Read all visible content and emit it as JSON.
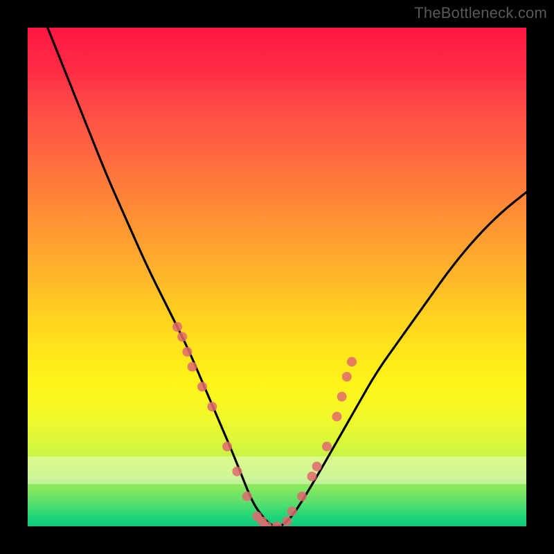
{
  "watermark": "TheBottleneck.com",
  "chart_data": {
    "type": "line",
    "title": "",
    "xlabel": "",
    "ylabel": "",
    "xlim": [
      0,
      100
    ],
    "ylim": [
      0,
      100
    ],
    "grid": false,
    "legend": false,
    "series": [
      {
        "name": "bottleneck-curve",
        "x": [
          4,
          8,
          12,
          16,
          20,
          24,
          28,
          32,
          35,
          38,
          41,
          43,
          45,
          47,
          49,
          51,
          53,
          55,
          58,
          62,
          66,
          70,
          75,
          80,
          85,
          90,
          95,
          100
        ],
        "values": [
          100,
          90,
          80,
          70,
          61,
          52,
          44,
          36,
          29,
          22,
          15,
          10,
          5,
          2,
          0,
          0,
          2,
          5,
          10,
          17,
          24,
          31,
          38,
          45,
          52,
          58,
          63,
          67
        ]
      }
    ],
    "markers": {
      "name": "bottleneck-points",
      "color": "#e06a6f",
      "x": [
        30,
        31,
        32,
        33,
        35,
        37,
        40,
        42,
        44,
        46,
        47,
        48,
        50,
        52,
        53,
        55,
        57,
        58,
        60,
        62,
        63,
        64,
        65
      ],
      "values": [
        40,
        38,
        35,
        32,
        28,
        24,
        16,
        11,
        6,
        2,
        1,
        0,
        0,
        1,
        3,
        6,
        10,
        12,
        16,
        22,
        26,
        30,
        33
      ]
    },
    "bottom_green_strip_y": 2,
    "pale_band_y": [
      10,
      14
    ]
  }
}
